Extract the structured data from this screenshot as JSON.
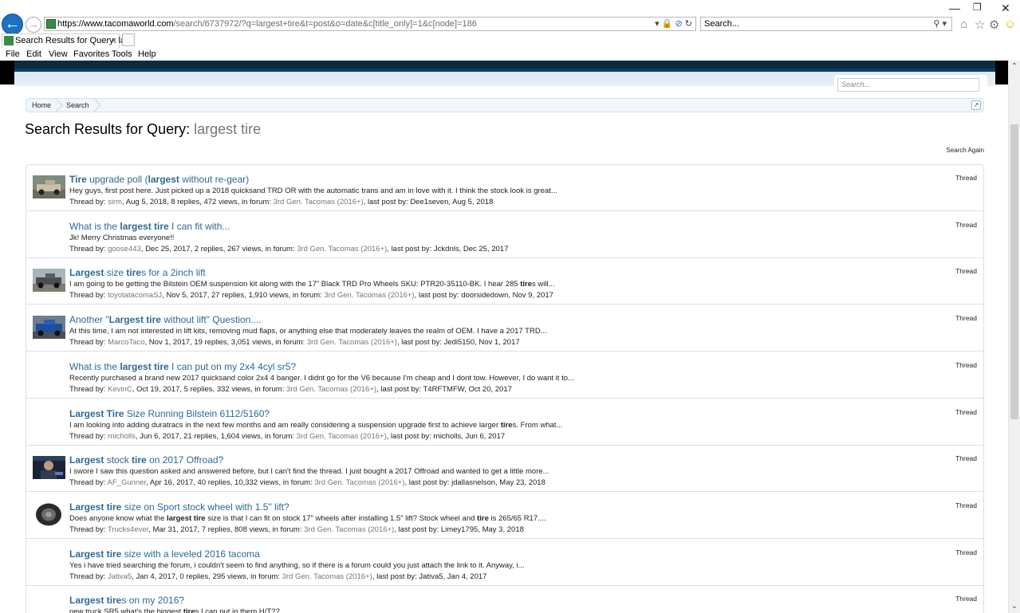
{
  "browser": {
    "url_host": "https://www.tacomaworld.com",
    "url_path": "/search/6737972/?q=largest+tire&t=post&o=date&c[title_only]=1&c[node]=186",
    "search_placeholder": "Search...",
    "tab_title": "Search Results for Query: la...",
    "tab_close": "×",
    "menu": [
      "File",
      "Edit",
      "View",
      "Favorites",
      "Tools",
      "Help"
    ],
    "icons": [
      "home-icon",
      "star-icon",
      "gear-icon",
      "smiley-icon"
    ]
  },
  "page": {
    "search_placeholder": "Search...",
    "breadcrumb": [
      "Home",
      "Search"
    ],
    "title_prefix": "Search Results for Query: ",
    "title_query": "largest tire",
    "search_again": "Search Again"
  },
  "results": [
    {
      "thumb": "truck-sand",
      "title_parts": [
        [
          "b",
          "Tire"
        ],
        [
          "n",
          " upgrade poll ("
        ],
        [
          "b",
          "largest"
        ],
        [
          "n",
          " without re-gear)"
        ]
      ],
      "snippet_parts": [
        [
          "n",
          "Hey guys, first post here. Just picked up a 2018 quicksand TRD OR with the automatic trans and am in love with it. I think the stock look is great..."
        ]
      ],
      "meta_lead": "Thread by: ",
      "author": "sirm",
      "meta_mid": ", Aug 5, 2018, 8 replies, 472 views, in forum: ",
      "forum": "3rd Gen. Tacomas (2016+)",
      "meta_tail": ", last post by: Dee1seven, Aug 5, 2018",
      "type": "Thread"
    },
    {
      "thumb": "",
      "title_parts": [
        [
          "n",
          "What is the "
        ],
        [
          "b",
          "largest tire"
        ],
        [
          "n",
          " I can fit with..."
        ]
      ],
      "snippet_parts": [
        [
          "n",
          "Jk! Merry Christmas everyone!!"
        ]
      ],
      "meta_lead": "Thread by: ",
      "author": "goose443",
      "meta_mid": ", Dec 25, 2017, 2 replies, 267 views, in forum: ",
      "forum": "3rd Gen. Tacomas (2016+)",
      "meta_tail": ", last post by: Jckdnls, Dec 25, 2017",
      "type": "Thread"
    },
    {
      "thumb": "truck-gray",
      "title_parts": [
        [
          "b",
          "Largest"
        ],
        [
          "n",
          " size "
        ],
        [
          "b",
          "tire"
        ],
        [
          "n",
          "s for a 2inch lift"
        ]
      ],
      "snippet_parts": [
        [
          "n",
          "I am going to be getting the Bilstein OEM suspension kit along with the 17” Black TRD Pro Wheels SKU: PTR20-35110-BK. I hear 285 "
        ],
        [
          "b",
          "tire"
        ],
        [
          "n",
          "s will..."
        ]
      ],
      "meta_lead": "Thread by: ",
      "author": "toyotatacomaSJ",
      "meta_mid": ", Nov 5, 2017, 27 replies, 1,910 views, in forum: ",
      "forum": "3rd Gen. Tacomas (2016+)",
      "meta_tail": ", last post by: doorsidedown, Nov 9, 2017",
      "type": "Thread"
    },
    {
      "thumb": "truck-blue",
      "title_parts": [
        [
          "n",
          "Another \""
        ],
        [
          "b",
          "Largest tire"
        ],
        [
          "n",
          " without lift\" Question...."
        ]
      ],
      "snippet_parts": [
        [
          "n",
          "At this time, I am not interested in lift kits, removing mud flaps, or anything else that moderately leaves the realm of OEM. I have a 2017 TRD..."
        ]
      ],
      "meta_lead": "Thread by: ",
      "author": "MarcoTaco",
      "meta_mid": ", Nov 1, 2017, 19 replies, 3,051 views, in forum: ",
      "forum": "3rd Gen. Tacomas (2016+)",
      "meta_tail": ", last post by: Jedi5150, Nov 1, 2017",
      "type": "Thread"
    },
    {
      "thumb": "",
      "title_parts": [
        [
          "n",
          "What is the "
        ],
        [
          "b",
          "largest tire"
        ],
        [
          "n",
          " I can put on my 2x4 4cyl sr5?"
        ]
      ],
      "snippet_parts": [
        [
          "n",
          "Recently purchased a brand new 2017 quicksand color 2x4 4 banger. I didnt go for the V6 because I'm cheap and I dont tow. However, I do want it to..."
        ]
      ],
      "meta_lead": "Thread by: ",
      "author": "KevinC",
      "meta_mid": ", Oct 19, 2017, 5 replies, 332 views, in forum: ",
      "forum": "3rd Gen. Tacomas (2016+)",
      "meta_tail": ", last post by: T4RFTMFW, Oct 20, 2017",
      "type": "Thread"
    },
    {
      "thumb": "",
      "title_parts": [
        [
          "b",
          "Largest Tire"
        ],
        [
          "n",
          " Size Running Bilstein 6112/5160?"
        ]
      ],
      "snippet_parts": [
        [
          "n",
          "I am looking into adding duratracs in the next few months and am really considering a suspension upgrade first to achieve larger "
        ],
        [
          "b",
          "tire"
        ],
        [
          "n",
          "s. From what..."
        ]
      ],
      "meta_lead": "Thread by: ",
      "author": "rnicholls",
      "meta_mid": ", Jun 6, 2017, 21 replies, 1,604 views, in forum: ",
      "forum": "3rd Gen. Tacomas (2016+)",
      "meta_tail": ", last post by: rnicholls, Jun 6, 2017",
      "type": "Thread"
    },
    {
      "thumb": "person",
      "title_parts": [
        [
          "b",
          "Largest"
        ],
        [
          "n",
          " stock "
        ],
        [
          "b",
          "tire"
        ],
        [
          "n",
          " on 2017 Offroad?"
        ]
      ],
      "snippet_parts": [
        [
          "n",
          "I swore I saw this question asked and answered before, but I can't find the thread. I just bought a 2017 Offroad and wanted to get a little more..."
        ]
      ],
      "meta_lead": "Thread by: ",
      "author": "AF_Gunner",
      "meta_mid": ", Apr 16, 2017, 40 replies, 10,332 views, in forum: ",
      "forum": "3rd Gen. Tacomas (2016+)",
      "meta_tail": ", last post by: jdallasnelson, May 23, 2018",
      "type": "Thread"
    },
    {
      "thumb": "tire",
      "title_parts": [
        [
          "b",
          "Largest tire"
        ],
        [
          "n",
          " size on Sport stock wheel with 1.5\" lift?"
        ]
      ],
      "snippet_parts": [
        [
          "n",
          "Does anyone know what the "
        ],
        [
          "b",
          "largest tire"
        ],
        [
          "n",
          " size is that I can fit on stock 17\" wheels after installing 1.5\" lift? Stock wheel and "
        ],
        [
          "b",
          "tire"
        ],
        [
          "n",
          " is 265/65 R17...."
        ]
      ],
      "meta_lead": "Thread by: ",
      "author": "Trucks4ever",
      "meta_mid": ", Mar 31, 2017, 7 replies, 808 views, in forum: ",
      "forum": "3rd Gen. Tacomas (2016+)",
      "meta_tail": ", last post by: Limey1795, May 3, 2018",
      "type": "Thread"
    },
    {
      "thumb": "",
      "title_parts": [
        [
          "b",
          "Largest tire"
        ],
        [
          "n",
          " size with a leveled 2016 tacoma"
        ]
      ],
      "snippet_parts": [
        [
          "n",
          "Yes i have tried searching the forum, i couldn't seem to find anything, so if there is a forum could you just attach the link to it. Anyway, i..."
        ]
      ],
      "meta_lead": "Thread by: ",
      "author": "Jativa5",
      "meta_mid": ", Jan 4, 2017, 0 replies, 295 views, in forum: ",
      "forum": "3rd Gen. Tacomas (2016+)",
      "meta_tail": ", last post by: Jativa5, Jan 4, 2017",
      "type": "Thread"
    },
    {
      "thumb": "",
      "title_parts": [
        [
          "b",
          "Largest tire"
        ],
        [
          "n",
          "s on my 2016?"
        ]
      ],
      "snippet_parts": [
        [
          "n",
          "new truck SR5 what's the biggest "
        ],
        [
          "b",
          "tire"
        ],
        [
          "n",
          "s I can put in them H/T??"
        ]
      ],
      "meta_lead": "",
      "author": "",
      "meta_mid": "",
      "forum": "",
      "meta_tail": "",
      "type": "Thread"
    }
  ]
}
